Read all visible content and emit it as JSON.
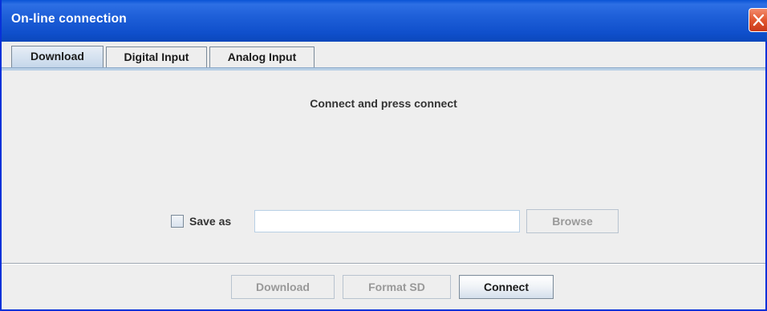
{
  "window": {
    "title": "On-line connection",
    "close_icon": "close-icon"
  },
  "tabs": [
    {
      "label": "Download",
      "active": true
    },
    {
      "label": "Digital Input",
      "active": false
    },
    {
      "label": "Analog Input",
      "active": false
    }
  ],
  "main": {
    "message": "Connect and press connect",
    "save_as": {
      "label": "Save as",
      "checked": false,
      "value": "",
      "browse_label": "Browse",
      "browse_enabled": false
    }
  },
  "footer": {
    "download_label": "Download",
    "download_enabled": false,
    "format_label": "Format SD",
    "format_enabled": false,
    "connect_label": "Connect",
    "connect_enabled": true
  },
  "colors": {
    "titlebar": "#0a53d6",
    "close_button": "#e2572f",
    "active_tab": "#c4d6ea",
    "background": "#eeeeee"
  }
}
